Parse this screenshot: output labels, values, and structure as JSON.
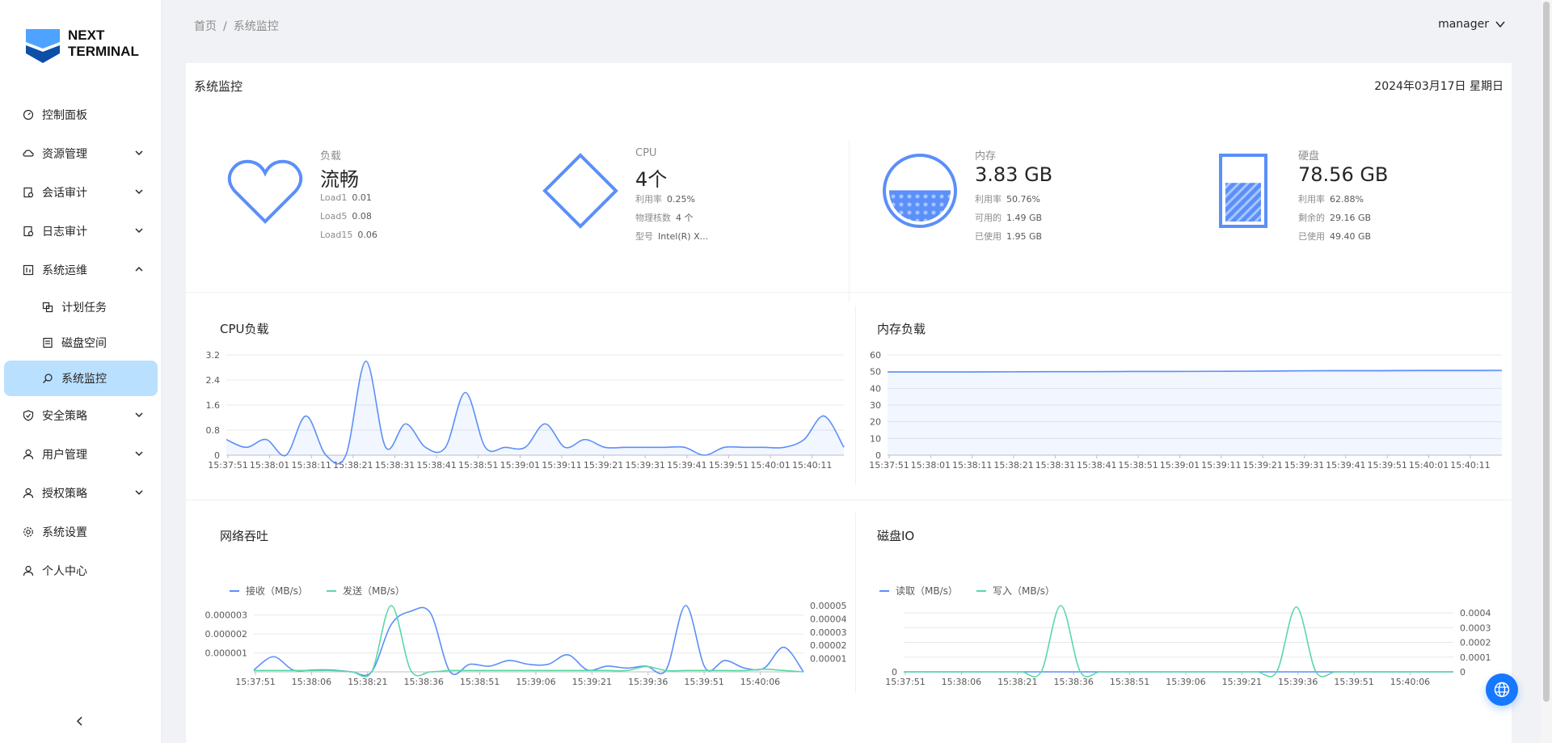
{
  "logo": {
    "line1": "NEXT",
    "line2": "TERMINAL"
  },
  "menu": {
    "items": [
      {
        "label": "控制面板"
      },
      {
        "label": "资源管理"
      },
      {
        "label": "会话审计"
      },
      {
        "label": "日志审计"
      },
      {
        "label": "系统运维"
      },
      {
        "label": "计划任务"
      },
      {
        "label": "磁盘空间"
      },
      {
        "label": "系统监控"
      },
      {
        "label": "安全策略"
      },
      {
        "label": "用户管理"
      },
      {
        "label": "授权策略"
      },
      {
        "label": "系统设置"
      },
      {
        "label": "个人中心"
      }
    ]
  },
  "breadcrumb": {
    "home": "首页",
    "sep": "/",
    "current": "系统监控"
  },
  "header": {
    "user": "manager"
  },
  "page": {
    "title": "系统监控",
    "date": "2024年03月17日 星期日"
  },
  "stats": {
    "load": {
      "label": "负载",
      "value": "流畅",
      "load1_label": "Load1",
      "load1": "0.01",
      "load5_label": "Load5",
      "load5": "0.08",
      "load15_label": "Load15",
      "load15": "0.06"
    },
    "cpu": {
      "label": "CPU",
      "value": "4个",
      "usage_label": "利用率",
      "usage": "0.25%",
      "cores_label": "物理核数",
      "cores": "4 个",
      "model_label": "型号",
      "model": "Intel(R) X..."
    },
    "mem": {
      "label": "内存",
      "value": "3.83 GB",
      "usage_label": "利用率",
      "usage": "50.76%",
      "avail_label": "可用的",
      "avail": "1.49 GB",
      "used_label": "已使用",
      "used": "1.95 GB",
      "fill_percent": 50.76
    },
    "disk": {
      "label": "硬盘",
      "value": "78.56 GB",
      "usage_label": "利用率",
      "usage": "62.88%",
      "free_label": "剩余的",
      "free": "29.16 GB",
      "used_label": "已使用",
      "used": "49.40 GB",
      "fill_percent": 62.88
    }
  },
  "colors": {
    "accent": "#5b8ff9",
    "green": "#5ad8a6",
    "active_bg": "#bae0ff",
    "primary": "#1677ff"
  },
  "chart_data": [
    {
      "id": "cpu",
      "type": "area",
      "title": "CPU负载",
      "x": [
        "15:37:51",
        "15:38:01",
        "15:38:11",
        "15:38:21",
        "15:38:31",
        "15:38:41",
        "15:38:51",
        "15:39:01",
        "15:39:11",
        "15:39:21",
        "15:39:31",
        "15:39:41",
        "15:39:51",
        "15:40:01",
        "15:40:11"
      ],
      "y_ticks": [
        "0",
        "0.8",
        "1.6",
        "2.4",
        "3.2"
      ],
      "ylim": [
        0,
        3.2
      ],
      "series": [
        {
          "values": [
            0.5,
            0.25,
            0.5,
            0,
            1.25,
            0,
            0,
            3.0,
            0.25,
            1.0,
            0.25,
            0.25,
            2.0,
            0.25,
            0.25,
            0.25,
            1.0,
            0.25,
            0.5,
            0.25,
            0.25,
            0.25,
            0.25,
            0.25,
            0,
            0.25,
            0.25,
            0.25,
            0.25,
            0.5,
            1.25,
            0.25
          ]
        }
      ]
    },
    {
      "id": "mem",
      "type": "area",
      "title": "内存负载",
      "x": [
        "15:37:51",
        "15:38:01",
        "15:38:11",
        "15:38:21",
        "15:38:31",
        "15:38:41",
        "15:38:51",
        "15:39:01",
        "15:39:11",
        "15:39:21",
        "15:39:31",
        "15:39:41",
        "15:39:51",
        "15:40:01",
        "15:40:11"
      ],
      "y_ticks": [
        "0",
        "10",
        "20",
        "30",
        "40",
        "50",
        "60"
      ],
      "ylim": [
        0,
        60
      ],
      "series": [
        {
          "values": [
            49.8,
            49.8,
            49.8,
            49.9,
            50.0,
            50.0,
            50.1,
            50.1,
            50.2,
            50.3,
            50.5,
            50.6,
            50.6,
            50.7,
            50.7,
            50.8
          ]
        }
      ]
    },
    {
      "id": "net",
      "type": "line",
      "title": "网络吞吐",
      "legend": [
        "接收（MB/s）",
        "发送（MB/s）"
      ],
      "x": [
        "15:37:51",
        "15:38:06",
        "15:38:21",
        "15:38:36",
        "15:38:51",
        "15:39:06",
        "15:39:21",
        "15:39:36",
        "15:39:51",
        "15:40:06"
      ],
      "y_ticks_left": [
        "0.000001",
        "0.000002",
        "0.000003"
      ],
      "ylim_left": [
        0,
        3.5e-06
      ],
      "y_ticks_right": [
        "0.00001",
        "0.00002",
        "0.00003",
        "0.00004",
        "0.00005"
      ],
      "ylim_right": [
        0,
        5e-05
      ],
      "series": [
        {
          "name": "接收（MB/s）",
          "axis": "left",
          "values": [
            1e-07,
            8e-07,
            1e-07,
            1e-07,
            1e-07,
            0,
            0,
            2.5e-06,
            3.2e-06,
            3.1e-06,
            0,
            4e-07,
            3e-07,
            6e-07,
            4e-07,
            4e-07,
            9e-07,
            1e-07,
            3e-07,
            2e-07,
            3e-07,
            1e-07,
            3.5e-06,
            2e-07,
            6e-07,
            2e-07,
            2e-07,
            1.3e-06,
            0
          ]
        },
        {
          "name": "发送（MB/s）",
          "axis": "right",
          "values": [
            1e-06,
            1e-06,
            1e-06,
            1e-06,
            1e-06,
            0,
            0,
            5.1e-05,
            1e-06,
            0,
            1e-06,
            1e-06,
            1e-06,
            1e-06,
            1e-06,
            1e-06,
            1e-06,
            1e-06,
            1e-06,
            1e-06,
            4e-06,
            1e-06,
            1e-06,
            1e-06,
            1e-06,
            1e-06,
            2e-06,
            1e-06,
            0
          ]
        }
      ]
    },
    {
      "id": "disk",
      "type": "line",
      "title": "磁盘IO",
      "legend": [
        "读取（MB/s）",
        "写入（MB/s）"
      ],
      "x": [
        "15:37:51",
        "15:38:06",
        "15:38:21",
        "15:38:36",
        "15:38:51",
        "15:39:06",
        "15:39:21",
        "15:39:36",
        "15:39:51",
        "15:40:06"
      ],
      "y_ticks_left": [
        "0"
      ],
      "y_ticks_right": [
        "0",
        "0.0001",
        "0.0002",
        "0.0003",
        "0.0004"
      ],
      "ylim_right": [
        0,
        0.00045
      ],
      "series": [
        {
          "name": "读取（MB/s）",
          "axis": "right",
          "values": [
            0,
            0,
            0,
            0,
            0,
            0,
            0,
            0,
            0,
            0,
            0,
            0,
            0,
            0,
            0,
            0,
            0,
            0,
            0,
            0,
            0,
            0,
            0,
            0,
            0,
            0,
            0,
            0,
            0
          ]
        },
        {
          "name": "写入（MB/s）",
          "axis": "right",
          "values": [
            0,
            0,
            0,
            0,
            0,
            0,
            0,
            0,
            0.00045,
            0,
            0,
            0,
            0,
            0,
            0,
            0,
            0,
            0,
            0,
            0,
            0.00044,
            0,
            0,
            0,
            0,
            0,
            0,
            0,
            0
          ]
        }
      ]
    }
  ]
}
